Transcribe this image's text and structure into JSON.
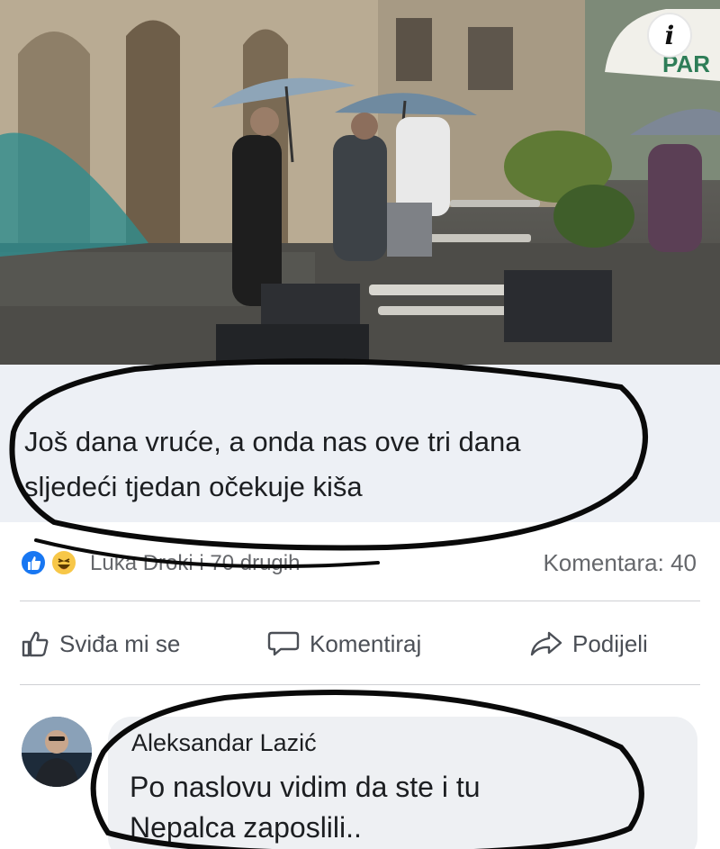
{
  "photo": {
    "info_icon": "info-icon",
    "sign_text": "PAR"
  },
  "post": {
    "caption_line1": "Još dana vruće, a onda nas ove tri dana",
    "caption_line2": "sljedeći tjedan očekuje kiša",
    "reaction_icons": [
      "like-icon",
      "haha-icon"
    ],
    "reactions_text": "Luka Droki i 70 drugih",
    "comments_count": "Komentara: 40"
  },
  "actions": {
    "like_label": "Sviđa mi se",
    "comment_label": "Komentiraj",
    "share_label": "Podijeli"
  },
  "comment": {
    "author": "Aleksandar Lazić",
    "text_line1": "Po naslovu vidim da ste i tu",
    "text_line2": "Nepalca zaposlili.."
  },
  "colors": {
    "caption_bg": "#edf0f5",
    "like_blue": "#1877f2",
    "haha_yellow": "#f7c748",
    "ink": "#0a0a0a"
  }
}
